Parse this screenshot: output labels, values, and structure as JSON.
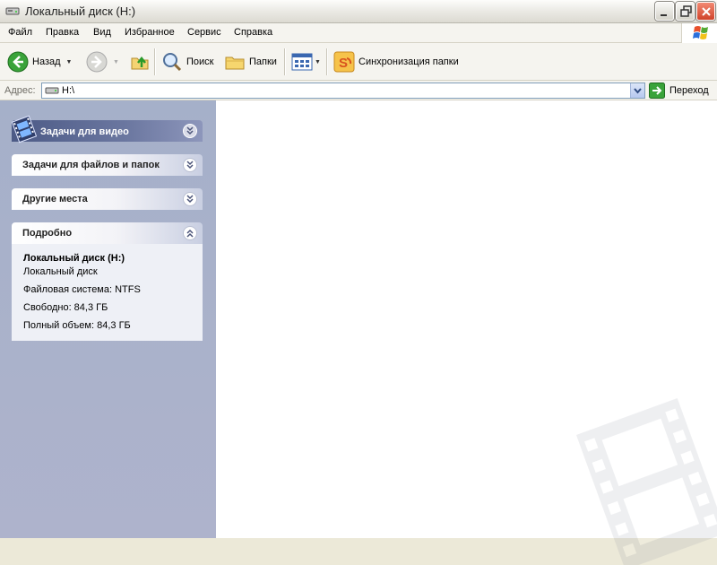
{
  "window": {
    "title": "Локальный диск (H:)"
  },
  "menu": [
    "Файл",
    "Правка",
    "Вид",
    "Избранное",
    "Сервис",
    "Справка"
  ],
  "toolbar": {
    "back_label": "Назад",
    "search_label": "Поиск",
    "folders_label": "Папки",
    "sync_label": "Синхронизация папки"
  },
  "address": {
    "label": "Адрес:",
    "value": "H:\\",
    "go_label": "Переход"
  },
  "tasks": {
    "video_title": "Задачи для видео",
    "files_title": "Задачи для файлов и папок",
    "places_title": "Другие места",
    "details_title": "Подробно"
  },
  "details": {
    "name": "Локальный диск (H:)",
    "type": "Локальный диск",
    "fs": "Файловая система: NTFS",
    "free": "Свободно: 84,3 ГБ",
    "total": "Полный объем: 84,3 ГБ"
  },
  "icons": {
    "title": "drive-icon",
    "back": "back-arrow-icon",
    "forward": "forward-arrow-icon",
    "up": "folder-up-icon",
    "search": "search-icon",
    "folders": "folders-icon",
    "views": "views-icon",
    "sync": "sync-icon",
    "go": "go-arrow-icon",
    "video": "film-icon",
    "watermark": "film-watermark-icon"
  },
  "colors": {
    "accent_green": "#3aa33a",
    "left_panel": "#a5accb",
    "address_border": "#7f9db9",
    "close_button": "#d0432a"
  }
}
